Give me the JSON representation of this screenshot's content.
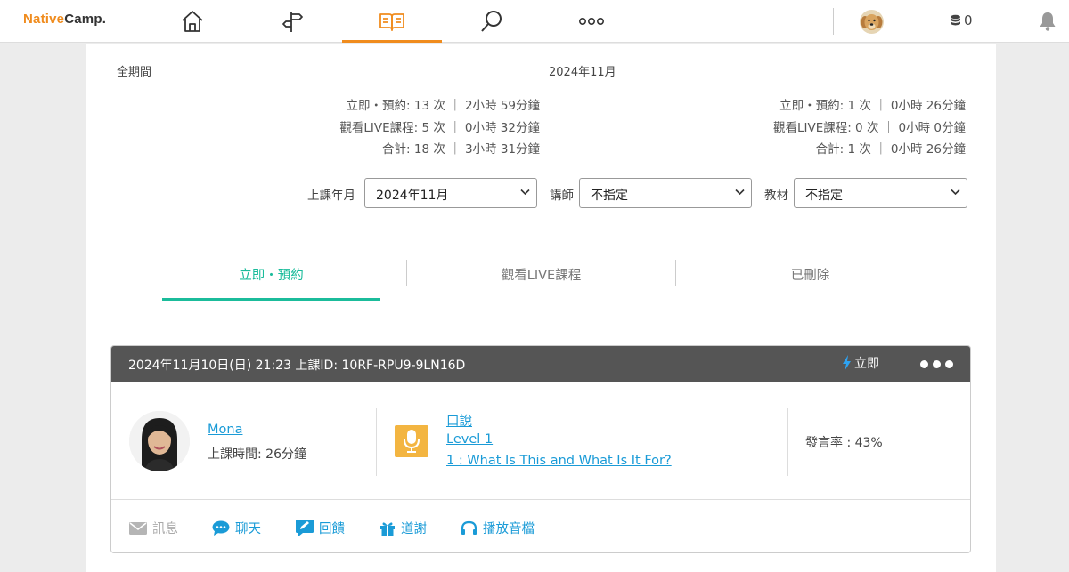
{
  "header": {
    "logo_part1": "Native",
    "logo_part2": "Camp.",
    "nav": [
      {
        "icon": "home-icon"
      },
      {
        "icon": "signpost-icon"
      },
      {
        "icon": "book-icon",
        "active": true
      },
      {
        "icon": "search-icon"
      },
      {
        "icon": "more-icon"
      }
    ],
    "coins": "0",
    "accent_color": "#f08c1e"
  },
  "stats": {
    "all_period": {
      "title": "全期間",
      "lines": [
        "立即・預約: 13 次 ｜ 2小時 59分鐘",
        "觀看LIVE課程: 5 次 ｜ 0小時 32分鐘",
        "合計: 18 次 ｜ 3小時 31分鐘"
      ]
    },
    "month": {
      "title": "2024年11月",
      "lines": [
        "立即・預約: 1 次 ｜ 0小時 26分鐘",
        "觀看LIVE課程: 0 次 ｜ 0小時 0分鐘",
        "合計: 1 次 ｜ 0小時 26分鐘"
      ]
    }
  },
  "filters": {
    "month_label": "上課年月",
    "month_value": "2024年11月",
    "teacher_label": "講師",
    "teacher_value": "不指定",
    "material_label": "教材",
    "material_value": "不指定"
  },
  "tabs": [
    {
      "label": "立即・預約",
      "active": true
    },
    {
      "label": "觀看LIVE課程"
    },
    {
      "label": "已刪除"
    }
  ],
  "tab_color": "#1bbc9b",
  "lesson": {
    "meta": "2024年11月10日(日) 21:23 上課ID: 10RF-RPU9-9LN16D",
    "type_label": "立即",
    "teacher_name": "Mona",
    "lesson_time": "上課時間: 26分鐘",
    "material_category": "口說",
    "material_level": "Level 1",
    "material_title": "1 : What Is This and What Is It For?",
    "speak_rate": "發言率 : 43%",
    "actions": [
      {
        "label": "訊息",
        "icon": "mail-icon",
        "enabled": false
      },
      {
        "label": "聊天",
        "icon": "chat-icon",
        "enabled": true
      },
      {
        "label": "回饋",
        "icon": "feedback-icon",
        "enabled": true
      },
      {
        "label": "道謝",
        "icon": "gift-icon",
        "enabled": true
      },
      {
        "label": "播放音檔",
        "icon": "headphones-icon",
        "enabled": true
      }
    ],
    "link_color": "#1a9bd7"
  }
}
